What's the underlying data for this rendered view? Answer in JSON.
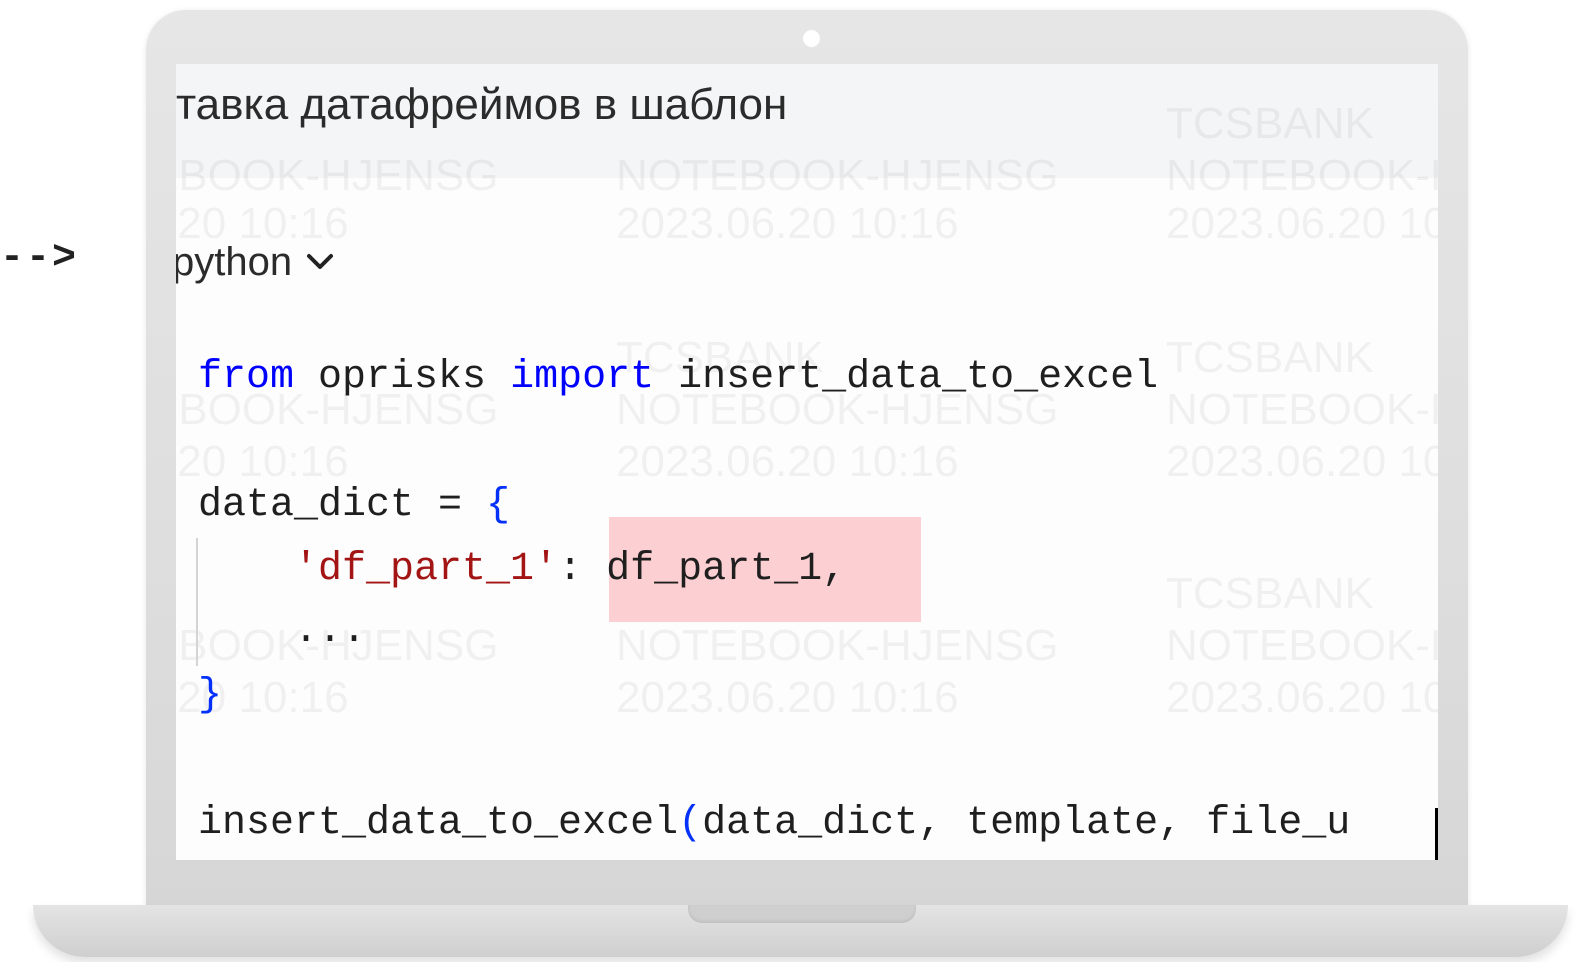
{
  "arrow_text": "-->",
  "page_title": "тавка датафреймов в шаблон",
  "language_selector": {
    "label": "python",
    "icon": "chevron-down-icon"
  },
  "watermark": {
    "org": "TCSBANK",
    "host": "NOTEBOOK-HJENSG",
    "datetime": "2023.06.20 10:16"
  },
  "code": {
    "line1": {
      "kw1": "from",
      "mod": " oprisks ",
      "kw2": "import",
      "rest": " insert_data_to_excel"
    },
    "line2": {
      "text": "data_dict = ",
      "brace": "{"
    },
    "line3": {
      "indent": "    ",
      "key": "'df_part_1'",
      "sep": ": ",
      "value": "df_part_1,"
    },
    "line4": {
      "text": "    ..."
    },
    "line5": {
      "brace": "}"
    },
    "line6": {
      "func": "insert_data_to_excel",
      "paren": "(",
      "args": "data_dict, template, file_u"
    }
  },
  "colors": {
    "keyword": "#0000ff",
    "string": "#a31515",
    "bracket": "#0431fa",
    "highlight": "#fcd0d2"
  }
}
